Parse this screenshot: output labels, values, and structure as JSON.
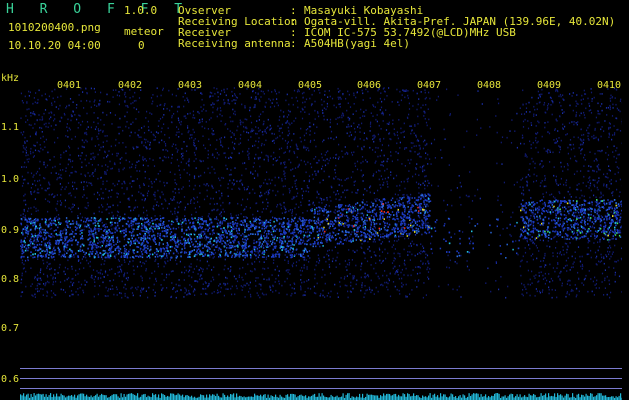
{
  "app": {
    "name": "H R O F F T",
    "version": "1.0.0"
  },
  "file": {
    "name": "1010200400.png",
    "datetime": "10.10.20 04:00"
  },
  "meteor": {
    "label": "meteor",
    "count": "0"
  },
  "info": [
    {
      "key": "Ovserver",
      "value": "Masayuki Kobayashi"
    },
    {
      "key": "Receiving Location",
      "value": "Ogata-vill. Akita-Pref. JAPAN (139.96E, 40.02N)"
    },
    {
      "key": "Receiver",
      "value": "ICOM IC-575 53.7492(@LCD)MHz USB"
    },
    {
      "key": "Receiving antenna",
      "value": "A504HB(yagi 4el)"
    }
  ],
  "yaxis": {
    "unit": "kHz",
    "ticks": [
      "1.1",
      "1.0",
      "0.9",
      "0.8",
      "0.7",
      "0.6"
    ]
  },
  "xaxis": {
    "ticks": [
      "0401",
      "0402",
      "0403",
      "0404",
      "0405",
      "0406",
      "0407",
      "0408",
      "0409",
      "0410"
    ]
  },
  "colors": {
    "header_label": "#39d39a",
    "tick_label": "#e6e63a",
    "signal_low": "#1a2aa0",
    "signal_mid": "#22c0e0",
    "signal_high": "#ff3020"
  }
}
